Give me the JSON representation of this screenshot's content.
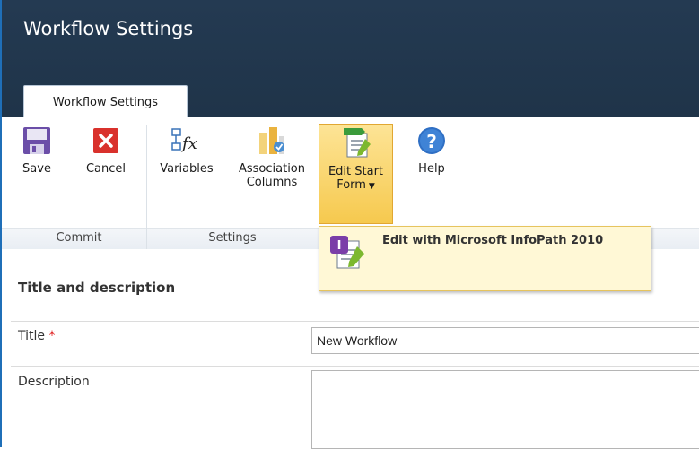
{
  "window": {
    "title": "Workflow Settings"
  },
  "ribbon": {
    "tab_label": "Workflow Settings",
    "groups": [
      {
        "label": "Commit"
      },
      {
        "label": "Settings"
      }
    ],
    "buttons": {
      "save": "Save",
      "cancel": "Cancel",
      "variables": "Variables",
      "association_line1": "Association",
      "association_line2": "Columns",
      "edit_start_line1": "Edit Start",
      "edit_start_line2": "Form",
      "help": "Help"
    },
    "dropdown_item": "Edit with Microsoft InfoPath 2010"
  },
  "form": {
    "section_title": "Title and description",
    "title_label": "Title",
    "required_mark": "*",
    "title_value": "New Workflow",
    "description_label": "Description",
    "description_value": ""
  },
  "colors": {
    "header_bg": "#243a52",
    "active_button_bg": "#f6c94e",
    "dropdown_bg": "#fff8d6",
    "required": "#e02020"
  }
}
